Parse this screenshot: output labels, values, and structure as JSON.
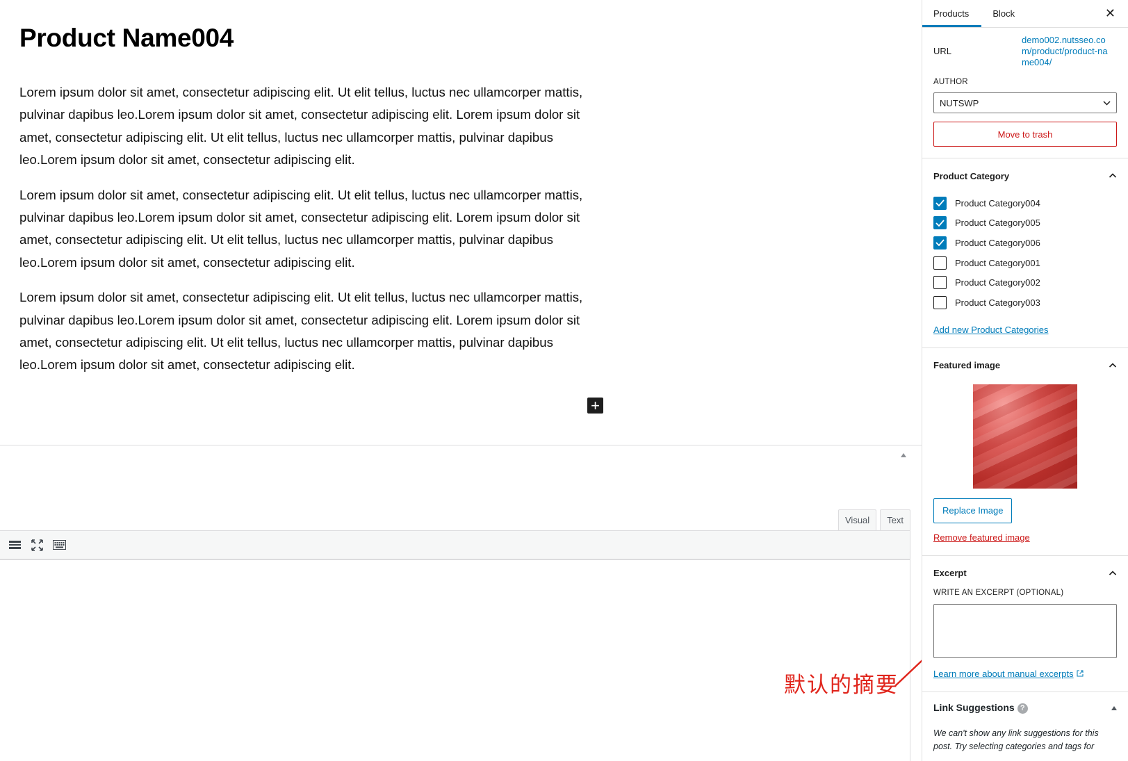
{
  "post": {
    "title": "Product Name004",
    "paragraphs": [
      "Lorem ipsum dolor sit amet, consectetur adipiscing elit. Ut elit tellus, luctus nec ullamcorper mattis, pulvinar dapibus leo.Lorem ipsum dolor sit amet, consectetur adipiscing elit. Lorem ipsum dolor sit amet, consectetur adipiscing elit. Ut elit tellus, luctus nec ullamcorper mattis, pulvinar dapibus leo.Lorem ipsum dolor sit amet, consectetur adipiscing elit.",
      "Lorem ipsum dolor sit amet, consectetur adipiscing elit. Ut elit tellus, luctus nec ullamcorper mattis, pulvinar dapibus leo.Lorem ipsum dolor sit amet, consectetur adipiscing elit. Lorem ipsum dolor sit amet, consectetur adipiscing elit. Ut elit tellus, luctus nec ullamcorper mattis, pulvinar dapibus leo.Lorem ipsum dolor sit amet, consectetur adipiscing elit.",
      "Lorem ipsum dolor sit amet, consectetur adipiscing elit. Ut elit tellus, luctus nec ullamcorper mattis, pulvinar dapibus leo.Lorem ipsum dolor sit amet, consectetur adipiscing elit. Lorem ipsum dolor sit amet, consectetur adipiscing elit. Ut elit tellus, luctus nec ullamcorper mattis, pulvinar dapibus leo.Lorem ipsum dolor sit amet, consectetur adipiscing elit."
    ],
    "add_block_symbol": "+"
  },
  "classic_editor": {
    "tabs": [
      "Visual",
      "Text"
    ],
    "toolbar_icons": [
      "toolbar-toggle-icon",
      "fullscreen-icon",
      "keyboard-icon"
    ]
  },
  "annotation": {
    "text": "默认的摘要",
    "color": "#e0251c"
  },
  "sidebar": {
    "tabs": {
      "products": "Products",
      "block": "Block"
    },
    "close_symbol": "✕",
    "url": {
      "label": "URL",
      "value": "demo002.nutsseo.com/product/product-name004/"
    },
    "author": {
      "label": "AUTHOR",
      "value": "NUTSWP"
    },
    "trash_label": "Move to trash",
    "category": {
      "title": "Product Category",
      "items": [
        {
          "label": "Product Category004",
          "checked": true
        },
        {
          "label": "Product Category005",
          "checked": true
        },
        {
          "label": "Product Category006",
          "checked": true
        },
        {
          "label": "Product Category001",
          "checked": false
        },
        {
          "label": "Product Category002",
          "checked": false
        },
        {
          "label": "Product Category003",
          "checked": false
        }
      ],
      "add_link": "Add new Product Categories"
    },
    "featured": {
      "title": "Featured image",
      "replace_label": "Replace Image",
      "remove_label": "Remove featured image"
    },
    "excerpt": {
      "title": "Excerpt",
      "label": "WRITE AN EXCERPT (OPTIONAL)",
      "value": "",
      "learn_link": "Learn more about manual excerpts"
    },
    "link_suggestions": {
      "title": "Link Suggestions",
      "help_symbol": "?",
      "text": "We can't show any link suggestions for this post. Try selecting categories and tags for"
    }
  },
  "colors": {
    "accent": "#007cba",
    "danger": "#cc1818"
  }
}
